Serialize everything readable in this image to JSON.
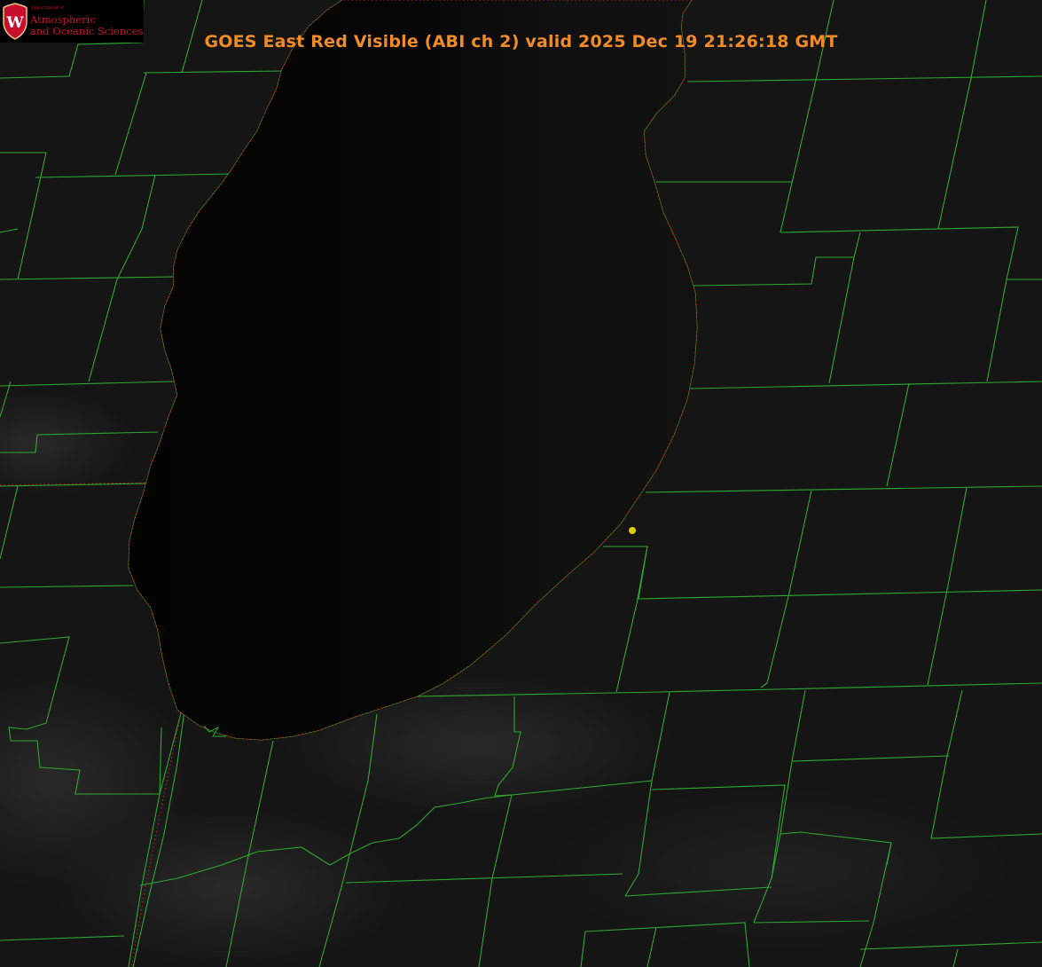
{
  "header": {
    "title": "GOES East Red Visible (ABI ch 2) valid 2025 Dec 19 21:26:18 GMT"
  },
  "logo": {
    "department": "Department of",
    "line1": "Atmospheric",
    "line2": "and Oceanic Sciences",
    "shield_letter": "W"
  },
  "colors": {
    "background": "#000000",
    "land": "#151515",
    "lake": "#050505",
    "county_borders": "#2ea82e",
    "shoreline": "#2ea82e",
    "shoreline_dots": "#d02020",
    "title": "#f08c28",
    "marker": "#d8d000",
    "logo_red": "#c8102e"
  },
  "map": {
    "marker": "yellow-dot-marker"
  }
}
